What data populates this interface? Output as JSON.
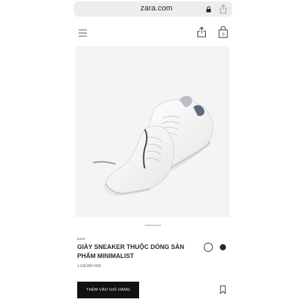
{
  "browser": {
    "url": "zara.com",
    "icons": [
      "lock-icon",
      "share-icon"
    ]
  },
  "header": {
    "icons": [
      "menu-icon",
      "share-icon",
      "shopping-bag-icon"
    ]
  },
  "product": {
    "badge": "NEW",
    "name": "GIÀY SNEAKER THUỘC DÒNG SẢN PHẨM MINIMALIST",
    "price": "1.199.000 VND",
    "colors": [
      "#ffffff",
      "#2b2b34"
    ],
    "selected_color_index": 0,
    "add_to_cart_label": "THÊM VÀO GIỎ HÀNG",
    "bookmark_icon": "bookmark-icon"
  }
}
